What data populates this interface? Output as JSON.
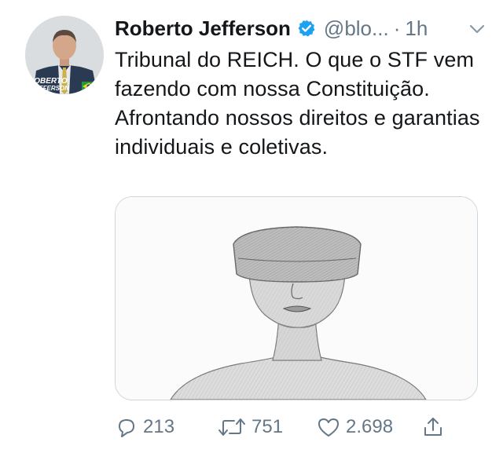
{
  "tweet": {
    "author": {
      "display_name": "Roberto Jefferson",
      "handle": "@blo...",
      "verified": true,
      "avatar_caption": [
        "ROBERTO",
        "JEFFERSON"
      ]
    },
    "separator": "·",
    "time": "1h",
    "text": "Tribunal do REICH. O que o STF vem fazendo com nossa Constituição. Afrontando nossos direitos e garantias individuais e coletivas.",
    "media_description": "drawing-of-blindfolded-justice-statue",
    "actions": {
      "reply_count": "213",
      "retweet_count": "751",
      "like_count": "2.698"
    }
  },
  "colors": {
    "text": "#14171a",
    "muted": "#657786",
    "verified_blue": "#1da1f2",
    "border": "#ccd6dd"
  },
  "icons": [
    "verified-badge-icon",
    "chevron-down-icon",
    "reply-icon",
    "retweet-icon",
    "like-icon",
    "share-icon"
  ]
}
